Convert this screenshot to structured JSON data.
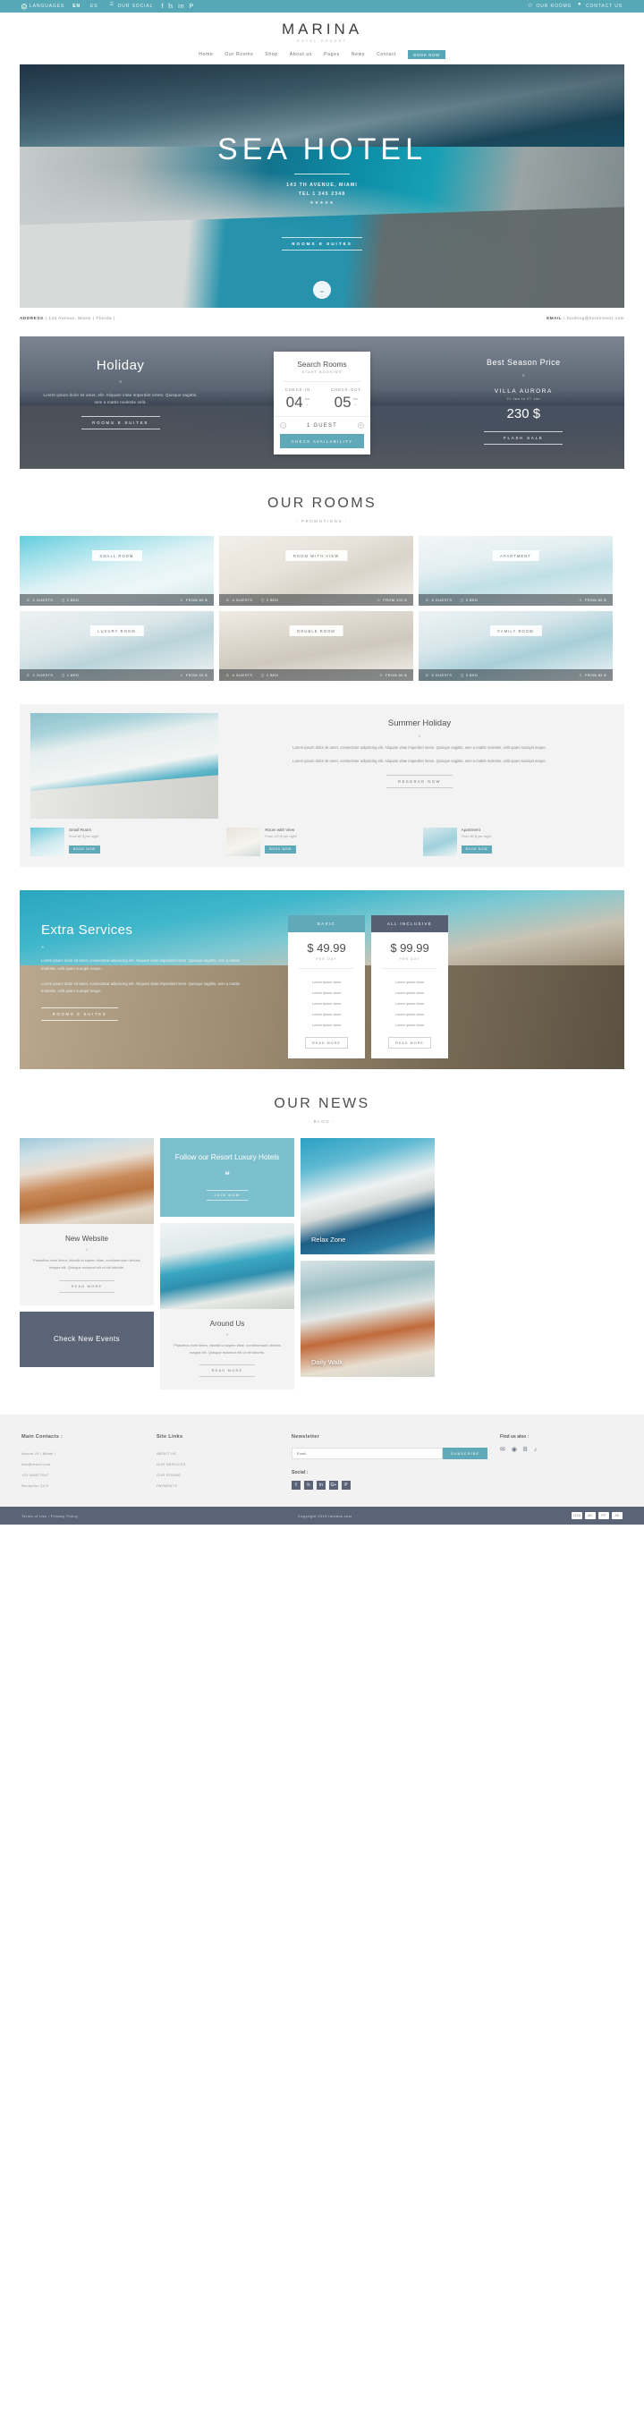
{
  "topbar": {
    "languages_label": "LANGUAGES",
    "languages": [
      {
        "code": "EN",
        "active": true
      },
      {
        "code": "ES",
        "active": false
      }
    ],
    "social_label": "OUR SOCIAL",
    "social_icons": [
      "facebook-icon",
      "twitter-icon",
      "linkedin-icon",
      "pinterest-icon"
    ],
    "social_glyphs": [
      "f",
      "𝕙",
      "in",
      "P"
    ],
    "right_links": [
      {
        "label": "OUR ROOMS",
        "icon": "star-icon"
      },
      {
        "label": "CONTACT US",
        "icon": "location-pin-icon"
      }
    ],
    "bg_color": "#57a8b6"
  },
  "header": {
    "logo": "MARINA",
    "logo_sub": "HOTEL RESORT",
    "nav": [
      {
        "label": "Home"
      },
      {
        "label": "Our Rooms"
      },
      {
        "label": "Shop"
      },
      {
        "label": "About us"
      },
      {
        "label": "Pages"
      },
      {
        "label": "News"
      },
      {
        "label": "Contact"
      }
    ],
    "cta": "BOOK NOW",
    "cta_color": "#57a8b6"
  },
  "hero": {
    "title": "SEA HOTEL",
    "address": "143 TH AVENUE, MIAMI",
    "tel": "TEL 1 345 2348",
    "stars": "★★★★★",
    "cta": "ROOMS E SUITES",
    "scroll_icon": "chevron-down-icon"
  },
  "address_strip": {
    "address_label": "ADDRESS :",
    "address_value": "143 Avenue, Miami ( Florida )",
    "email_label": "EMAIL :",
    "email_value": "booking@hotelresort.com"
  },
  "booking": {
    "left": {
      "title": "Holiday",
      "divider": "✕",
      "paragraph": "Lorem ipsum dolor sit amet, elit. Aliquam vitae imperdiet lorem. Quisque sagittis, sem a mattis molestie velit.",
      "button": "ROOMS E SUITES"
    },
    "search_card": {
      "title": "Search Rooms",
      "subtitle": "START BOOKING",
      "checkin_label": "CHECK-IN",
      "checkout_label": "CHECK-OUT",
      "checkin_day": "04",
      "checkin_month": "Jun",
      "checkout_day": "05",
      "checkout_month": "Jun",
      "guests": "1 GUEST",
      "minus": "−",
      "plus": "+",
      "submit": "CHECK AVAILABILITY",
      "submit_color": "#5fa9b8"
    },
    "right": {
      "title": "Best Season Price",
      "divider": "✕",
      "room": "VILLA AURORA",
      "dates": "21 Jan to 27 Jan",
      "price": "230 $",
      "button": "FLASH SALE"
    }
  },
  "rooms_section": {
    "title": "OUR ROOMS",
    "subtitle": "- PROMOTIONS -",
    "cards": [
      {
        "tag": "SMALL ROOM",
        "guests": "2 GUESTS",
        "beds": "1 BED",
        "price": "FROM 80 $",
        "guest_icon": "person-icon",
        "bed_icon": "bed-icon",
        "price_icon": "tag-icon"
      },
      {
        "tag": "ROOM WITH VIEW",
        "guests": "4 GUESTS",
        "beds": "2 BED",
        "price": "FROM 120 $",
        "guest_icon": "person-icon",
        "bed_icon": "bed-icon",
        "price_icon": "tag-icon"
      },
      {
        "tag": "APARTMENT",
        "guests": "6 GUESTS",
        "beds": "3 BED",
        "price": "FROM 80 $",
        "guest_icon": "person-icon",
        "bed_icon": "bed-icon",
        "price_icon": "tag-icon"
      },
      {
        "tag": "LUXURY ROOM",
        "guests": "2 GUESTS",
        "beds": "1 BED",
        "price": "FROM 90 $",
        "guest_icon": "person-icon",
        "bed_icon": "bed-icon",
        "price_icon": "tag-icon"
      },
      {
        "tag": "DOUBLE ROOM",
        "guests": "4 GUESTS",
        "beds": "2 BED",
        "price": "FROM 60 $",
        "guest_icon": "person-icon",
        "bed_icon": "bed-icon",
        "price_icon": "tag-icon"
      },
      {
        "tag": "FAMILY ROOM",
        "guests": "6 GUESTS",
        "beds": "3 BED",
        "price": "FROM 85 $",
        "guest_icon": "person-icon",
        "bed_icon": "bed-icon",
        "price_icon": "tag-icon"
      }
    ]
  },
  "summer": {
    "title": "Summer Holiday",
    "divider": "✕",
    "paragraph1": "Lorem ipsum dolor sit amet, consectetur adipiscing elit. Aliquam vitae imperdiet lorem. Quisque sagittis, sem a mattis molestie, velit quam suscipit neque.",
    "paragraph2": "Lorem ipsum dolor sit amet, consectetur adipiscing elit. Aliquam vitae imperdiet lorem. Quisque sagittis, sem a mattis molestie, velit quam suscipit neque.",
    "button": "RESERVE NOW",
    "promos": [
      {
        "name": "Small Room",
        "price": "From 80 $ per night",
        "button": "BOOK NOW"
      },
      {
        "name": "Room with View",
        "price": "From 120 $ per night",
        "button": "BOOK NOW"
      },
      {
        "name": "Apartment",
        "price": "From 80 $ per night",
        "button": "BOOK NOW"
      }
    ]
  },
  "extra": {
    "title": "Extra Services",
    "divider": "✕",
    "paragraph1": "Lorem ipsum dolor sit amet, consectetur adipiscing elit. Aliquam vitae imperdiet lorem. Quisque sagittis, sem a mattis molestie, velit quam suscipit neque.",
    "paragraph2": "Lorem ipsum dolor sit amet, consectetur adipiscing elit. Aliquam vitae imperdiet lorem. Quisque sagittis, sem a mattis molestie, velit quam suscipit neque.",
    "button": "ROOMS E SUITES",
    "plans": [
      {
        "name": "BASIC",
        "amount": "$ 49.99",
        "per": "PER DAY",
        "header_color": "#5fa9b8",
        "features": [
          "Lorem ipsum dolor",
          "Lorem ipsum dolor",
          "Lorem ipsum dolor",
          "Lorem ipsum dolor",
          "Lorem ipsum dolor"
        ],
        "button": "READ MORE"
      },
      {
        "name": "ALL INCLUSIVE",
        "amount": "$ 99.99",
        "per": "PER DAY",
        "header_color": "#565f73",
        "features": [
          "Lorem ipsum dolor",
          "Lorem ipsum dolor",
          "Lorem ipsum dolor",
          "Lorem ipsum dolor",
          "Lorem ipsum dolor"
        ],
        "button": "READ MORE"
      }
    ]
  },
  "news": {
    "title": "OUR NEWS",
    "subtitle": "- BLOG -",
    "article1": {
      "title": "New Website",
      "divider": "✕",
      "paragraph": "Phasellus enim libero, blandit ut sapien vitae, condimentum ultricies magna elit. Quisque euismod elit ut elit lobortis.",
      "button": "READ MORE"
    },
    "follow": {
      "title": "Follow our Resort Luxury Hotels",
      "quote_icon": "quote-icon",
      "button": "JOIN NOW",
      "bg_color": "#7cc0cd"
    },
    "article2": {
      "title": "Around Us",
      "divider": "✕",
      "paragraph": "Phasellus enim libero, blandit ut sapien vitae, condimentum ultricies magna elit. Quisque euismod elit ut elit lobortis.",
      "button": "READ MORE"
    },
    "events": {
      "label": "Check New Events",
      "bg_color": "#5b6476"
    },
    "overlay1": {
      "label": "Relax Zone"
    },
    "overlay2": {
      "label": "Daily Walk"
    }
  },
  "footer": {
    "col1": {
      "title": "Main Contacts :",
      "lines": [
        "Assure 24 / Miami /",
        "info@resort.com",
        "+23 546577647",
        "Reception 24 H"
      ]
    },
    "col2": {
      "title": "Site Links",
      "lines": [
        "ABOUT US",
        "OUR SERVICES",
        "OUR ROOMS",
        "PAYMENTS"
      ]
    },
    "col3": {
      "title": "Newsletter",
      "input_placeholder": "Email",
      "input_value": "",
      "submit": "SUBSCRIBE",
      "submit_color": "#5fa9b8",
      "social_title": "Social :",
      "social_glyphs": [
        "f",
        "𝕙",
        "in",
        "G+",
        "P"
      ],
      "social_icons": [
        "facebook-icon",
        "twitter-icon",
        "linkedin-icon",
        "googleplus-icon",
        "pinterest-icon"
      ]
    },
    "col4": {
      "title": "Find us also :",
      "glyphs": [
        "✉",
        "◉",
        "B",
        "♪"
      ],
      "icons": [
        "mail-icon",
        "circle-icon",
        "behance-icon",
        "music-icon"
      ]
    }
  },
  "bottombar": {
    "terms": "Terms of Use",
    "sep": "/",
    "privacy": "Privacy Policy",
    "copyright": "Copyright 2019 fordeck.com",
    "payments": [
      "VISA",
      "MC",
      "PP",
      "AE"
    ]
  }
}
